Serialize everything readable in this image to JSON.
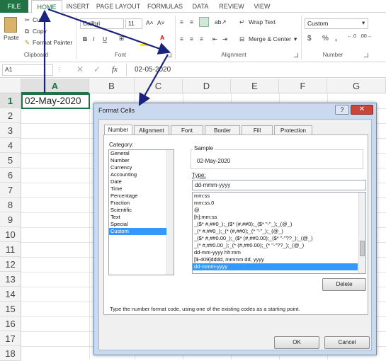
{
  "ribbon_tabs": [
    "FILE",
    "HOME",
    "INSERT",
    "PAGE LAYOUT",
    "FORMULAS",
    "DATA",
    "REVIEW",
    "VIEW"
  ],
  "clipboard": {
    "paste": "Paste",
    "cut": "Cut",
    "copy": "Copy",
    "format_painter": "Format Painter",
    "label": "Clipboard"
  },
  "font": {
    "name": "Calibri",
    "size": "11",
    "bold": "B",
    "italic": "I",
    "underline": "U",
    "label": "Font"
  },
  "alignment": {
    "wrap": "Wrap Text",
    "merge": "Merge & Center",
    "label": "Alignment"
  },
  "number": {
    "format": "Custom",
    "currency": "$",
    "percent": "%",
    "comma": ",",
    "label": "Number"
  },
  "formula_bar": {
    "name_box": "A1",
    "fx": "fx",
    "value": "02-05-2020"
  },
  "columns": [
    "A",
    "B",
    "C",
    "D",
    "E",
    "F",
    "G"
  ],
  "rows": [
    "1",
    "2",
    "3",
    "4",
    "5",
    "6",
    "7",
    "8",
    "9",
    "10",
    "11",
    "12",
    "13",
    "14",
    "15",
    "16",
    "17",
    "18"
  ],
  "cell_a1": "02-May-2020",
  "dialog": {
    "title": "Format Cells",
    "help": "?",
    "tabs": [
      "Number",
      "Alignment",
      "Font",
      "Border",
      "Fill",
      "Protection"
    ],
    "category_label": "Category:",
    "categories": [
      "General",
      "Number",
      "Currency",
      "Accounting",
      "Date",
      "Time",
      "Percentage",
      "Fraction",
      "Scientific",
      "Text",
      "Special",
      "Custom"
    ],
    "sample_label": "Sample",
    "sample_value": "02-May-2020",
    "type_label": "Type:",
    "type_value": "dd-mmm-yyyy",
    "formats": [
      "mm:ss",
      "mm:ss.0",
      "@",
      "[h]:mm:ss",
      "_($* #,##0_);_($* (#,##0);_($* \"-\"_);_(@_)",
      "_(* #,##0_);_(* (#,##0);_(* \"-\"_);_(@_)",
      "_($* #,##0.00_);_($* (#,##0.00);_($* \"-\"??_);_(@_)",
      "_(* #,##0.00_);_(* (#,##0.00);_(* \"-\"??_);_(@_)",
      "dd-mm-yyyy hh:mm",
      "[$-409]dddd, mmmm dd, yyyy",
      "dd-mmm-yyyy"
    ],
    "delete": "Delete",
    "hint": "Type the number format code, using one of the existing codes as a starting point.",
    "ok": "OK",
    "cancel": "Cancel"
  },
  "colors": {
    "excel_green": "#217346",
    "selection": "#3399ff",
    "arrow": "#1a237e"
  }
}
